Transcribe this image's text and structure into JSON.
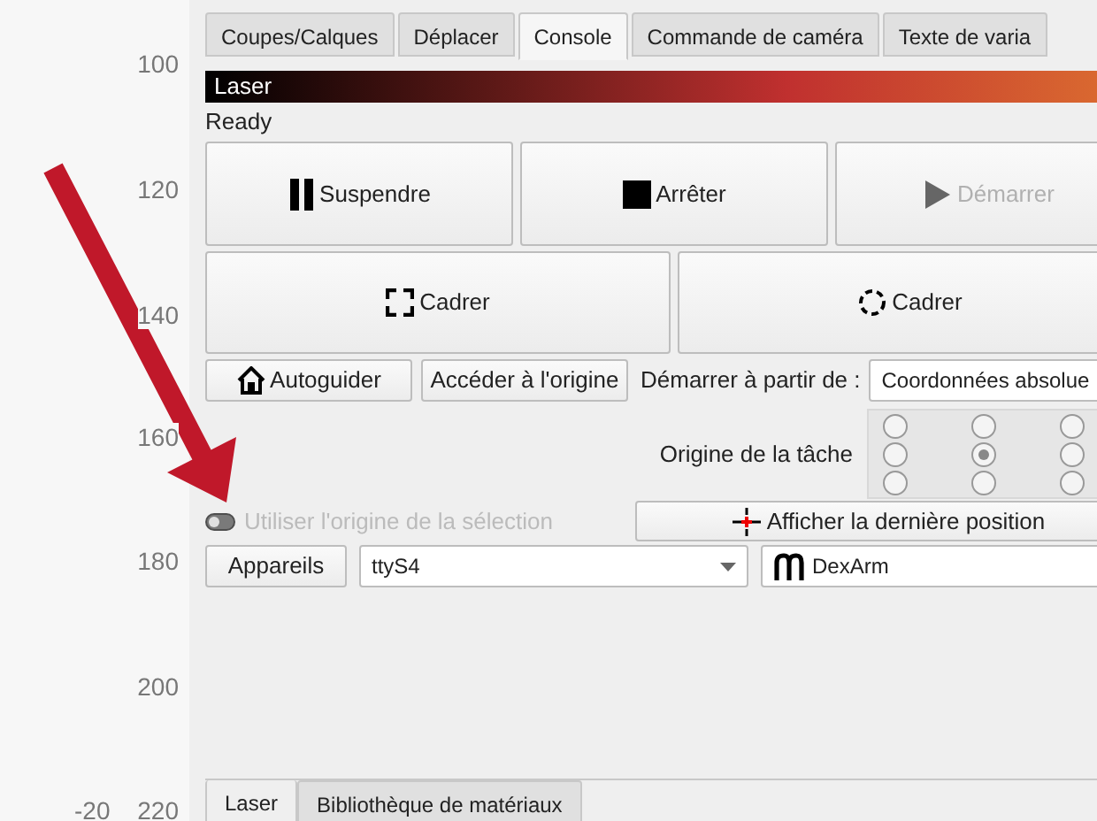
{
  "ruler": {
    "labels": [
      {
        "text": "100"
      },
      {
        "text": "120"
      },
      {
        "text": "140"
      },
      {
        "text": "160"
      },
      {
        "text": "180"
      },
      {
        "text": "200"
      },
      {
        "text": "220"
      }
    ],
    "horizontal_label": "-20"
  },
  "tabs": [
    {
      "label": "Coupes/Calques",
      "selected": false
    },
    {
      "label": "Déplacer",
      "selected": false
    },
    {
      "label": "Console",
      "selected": true
    },
    {
      "label": "Commande de caméra",
      "selected": false
    },
    {
      "label": "Texte de varia",
      "selected": false
    }
  ],
  "laser_panel": {
    "title": "Laser",
    "status": "Ready",
    "run_buttons": [
      {
        "label": "Suspendre",
        "disabled": false
      },
      {
        "label": "Arrêter",
        "disabled": false
      },
      {
        "label": "Démarrer",
        "disabled": true
      }
    ],
    "frame_buttons": [
      {
        "label": "Cadrer"
      },
      {
        "label": "Cadrer"
      }
    ],
    "home_button": "Autoguider",
    "origin_button": "Accéder à l'origine",
    "start_from_label": "Démarrer à partir de :",
    "start_from_value": "Coordonnées absolue",
    "job_origin_label": "Origine de la tâche",
    "job_origin": [
      {
        "selected": false
      },
      {
        "selected": false
      },
      {
        "selected": false
      },
      {
        "selected": false
      },
      {
        "selected": true
      },
      {
        "selected": false
      },
      {
        "selected": false
      },
      {
        "selected": false
      },
      {
        "selected": false
      }
    ],
    "use_selection_origin": {
      "label": "Utiliser l'origine de la sélection",
      "checked": false,
      "disabled": true
    },
    "show_position_button": "Afficher la dernière position",
    "devices_button": "Appareils",
    "port": "ttyS4",
    "device": "DexArm"
  },
  "bottom_tabs": [
    {
      "label": "Laser",
      "selected": true
    },
    {
      "label": "Bibliothèque de matériaux",
      "selected": false
    }
  ]
}
